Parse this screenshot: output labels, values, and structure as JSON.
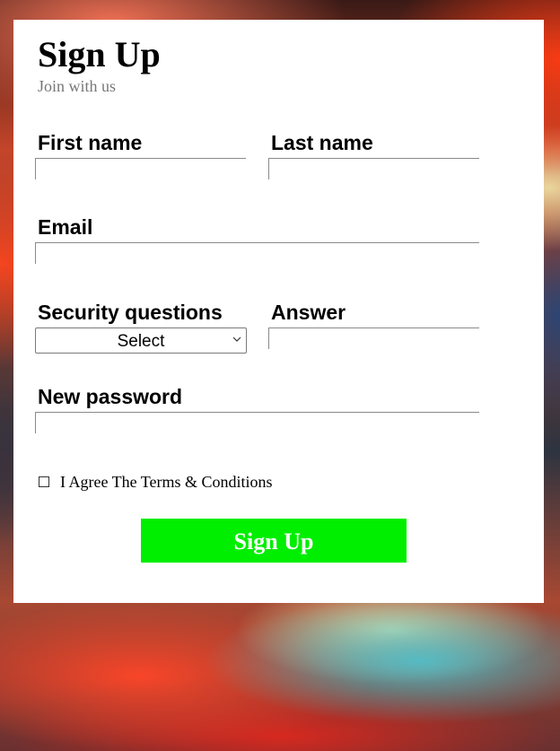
{
  "form": {
    "title": "Sign Up",
    "subtitle": "Join with us",
    "first_name_label": "First name",
    "last_name_label": "Last name",
    "email_label": "Email",
    "security_questions_label": "Security questions",
    "security_select_value": "Select",
    "answer_label": "Answer",
    "new_password_label": "New password",
    "terms_label": "I Agree The Terms & Conditions",
    "terms_checked": false,
    "submit_label": "Sign Up"
  },
  "colors": {
    "submit_background": "#00ee00",
    "submit_text": "#ffffff",
    "subtitle_text": "#777777",
    "card_background": "#ffffff"
  },
  "icons": {
    "select_arrow": "chevron-down-icon"
  }
}
